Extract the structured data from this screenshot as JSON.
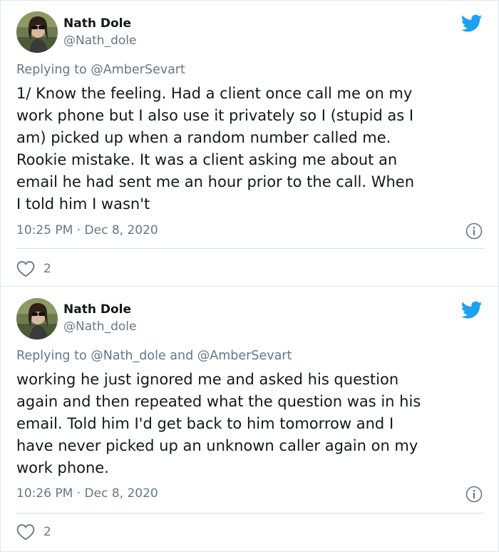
{
  "tweets": [
    {
      "author": {
        "name": "Nath Dole",
        "handle": "@Nath_dole"
      },
      "replying_to": {
        "prefix": "Replying to",
        "mentions": "@AmberSevart"
      },
      "lines": [
        "1/ Know the feeling. Had a client once call me on my",
        "work phone but I also use it privately so I (stupid as I",
        "am) picked up when a random number called me.",
        "Rookie mistake. It was a client asking me about an",
        "email he had sent me an hour prior to the call. When",
        "I told him I wasn't"
      ],
      "timestamp": "10:25 PM · Dec 8, 2020",
      "likes": "2"
    },
    {
      "author": {
        "name": "Nath Dole",
        "handle": "@Nath_dole"
      },
      "replying_to": {
        "prefix": "Replying to",
        "mentions": "@Nath_dole and @AmberSevart"
      },
      "lines": [
        "working he just ignored me and asked his question",
        "again and then repeated what the question was in his",
        "email. Told him I'd get back to him tomorrow and I",
        "have never picked up an unknown caller again on my",
        "work phone."
      ],
      "timestamp": "10:26 PM · Dec 8, 2020",
      "likes": "2"
    }
  ],
  "colors": {
    "text": "#14171a",
    "muted": "#657786",
    "twitter_blue": "#1da1f2",
    "divider": "#d6dde2"
  },
  "icons": [
    "twitter-bird-icon",
    "info-icon",
    "heart-icon"
  ]
}
